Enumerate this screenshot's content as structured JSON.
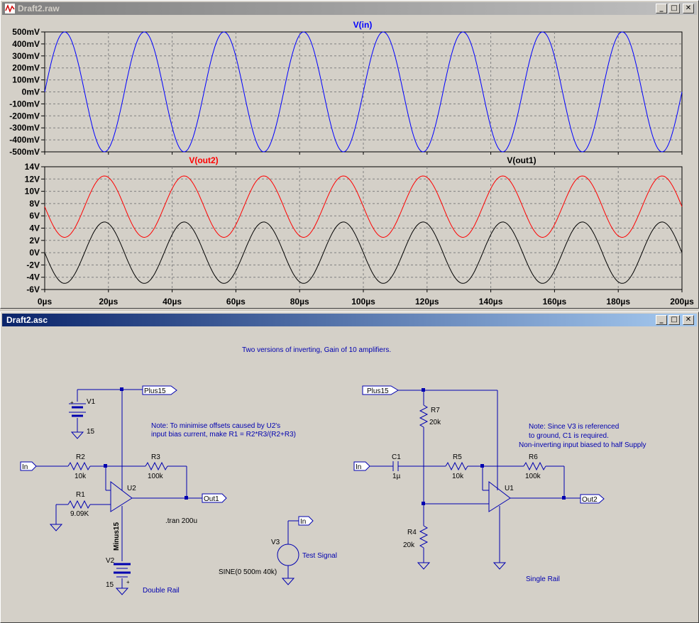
{
  "plot_window": {
    "title": "Draft2.raw",
    "buttons": {
      "minimize": "_",
      "maximize": "□",
      "close": "✕"
    }
  },
  "schem_window": {
    "title": "Draft2.asc",
    "buttons": {
      "minimize": "_",
      "maximize": "□",
      "close": "✕"
    }
  },
  "chart_data": [
    {
      "type": "line",
      "series": [
        {
          "name": "V(in)",
          "amplitude": 0.5,
          "offset": 0,
          "frequency_hz": 40000,
          "color": "#0000ff"
        }
      ],
      "x_range": [
        0,
        200
      ],
      "xlabel": "",
      "ylim": [
        -0.5,
        0.5
      ],
      "y_ticks": [
        "500mV",
        "400mV",
        "300mV",
        "200mV",
        "100mV",
        "0mV",
        "-100mV",
        "-200mV",
        "-300mV",
        "-400mV",
        "-500mV"
      ],
      "grid": true
    },
    {
      "type": "line",
      "series": [
        {
          "name": "V(out2)",
          "amplitude": 5,
          "offset": 7.5,
          "frequency_hz": 40000,
          "inverted": true,
          "color": "#ff0000"
        },
        {
          "name": "V(out1)",
          "amplitude": 5,
          "offset": 0,
          "frequency_hz": 40000,
          "inverted": true,
          "color": "#000000"
        }
      ],
      "x_range": [
        0,
        200
      ],
      "ylim": [
        -6,
        14
      ],
      "y_ticks": [
        "14V",
        "12V",
        "10V",
        "8V",
        "6V",
        "4V",
        "2V",
        "0V",
        "-2V",
        "-4V",
        "-6V"
      ],
      "x_ticks": [
        "0µs",
        "20µs",
        "40µs",
        "60µs",
        "80µs",
        "100µs",
        "120µs",
        "140µs",
        "160µs",
        "180µs",
        "200µs"
      ],
      "grid": true
    }
  ],
  "schematic": {
    "header_note": "Two versions of inverting, Gain of 10 amplifiers.",
    "left": {
      "net_plus15": "Plus15",
      "net_in": "In",
      "net_out1": "Out1",
      "v1_name": "V1",
      "v1_value": "15",
      "v2_name": "V2",
      "v2_value": "15",
      "minus15": "Minus15",
      "r2_name": "R2",
      "r2_value": "10k",
      "r3_name": "R3",
      "r3_value": "100k",
      "r1_name": "R1",
      "r1_value": "9.09K",
      "u2_name": "U2",
      "note_line1": "Note: To minimise offsets caused by U2's",
      "note_line2": "input bias current, make R1 = R2*R3/(R2+R3)",
      "tran": ".tran 200u",
      "label": "Double Rail",
      "plus_sign": "+"
    },
    "source": {
      "v3_name": "V3",
      "net_in": "In",
      "label": "Test Signal",
      "value": "SINE(0 500m 40k)"
    },
    "right": {
      "net_plus15": "Plus15",
      "net_in": "In",
      "net_out2": "Out2",
      "r7_name": "R7",
      "r7_value": "20k",
      "c1_name": "C1",
      "c1_value": "1µ",
      "r5_name": "R5",
      "r5_value": "10k",
      "r6_name": "R6",
      "r6_value": "100k",
      "r4_name": "R4",
      "r4_value": "20k",
      "u1_name": "U1",
      "note_line1": "Note: Since V3 is referenced",
      "note_line2": "to ground, C1 is required.",
      "note_line3": "Non-inverting input biased to half Supply",
      "label": "Single Rail"
    }
  }
}
